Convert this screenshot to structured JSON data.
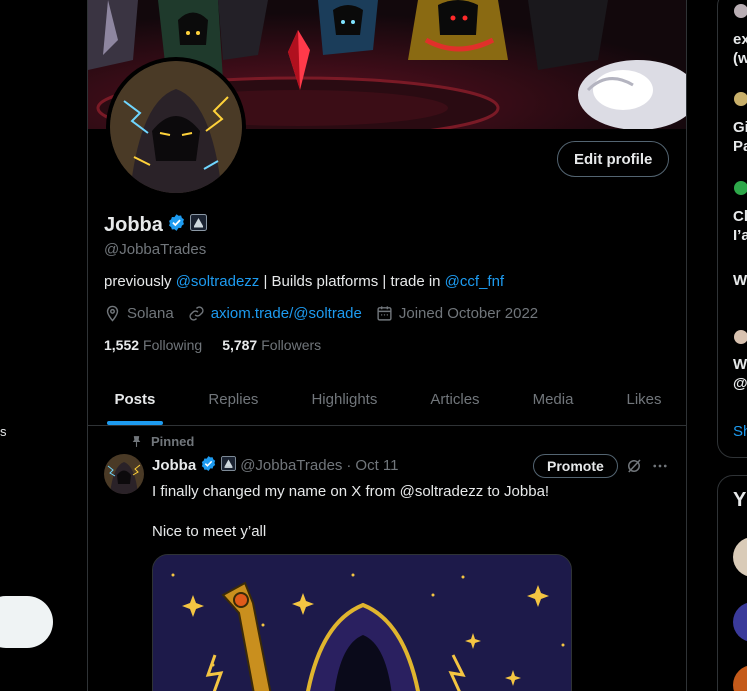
{
  "profile": {
    "display_name": "Jobba",
    "handle": "@JobbaTrades",
    "edit_button": "Edit profile",
    "bio": {
      "prefix": "previously ",
      "mention1": "@soltradezz",
      "middle": " | Builds platforms | trade in ",
      "mention2": "@ccf_fnf"
    },
    "location": "Solana",
    "website": "axiom.trade/@soltrade",
    "joined": "Joined October 2022",
    "following_count": "1,552",
    "following_label": "Following",
    "followers_count": "5,787",
    "followers_label": "Followers"
  },
  "tabs": [
    {
      "label": "Posts",
      "active": true
    },
    {
      "label": "Replies"
    },
    {
      "label": "Highlights"
    },
    {
      "label": "Articles"
    },
    {
      "label": "Media"
    },
    {
      "label": "Likes"
    }
  ],
  "tweet": {
    "pinned_label": "Pinned",
    "name": "Jobba",
    "handle": "@JobbaTrades",
    "separator": "·",
    "date": "Oct 11",
    "promote_label": "Promote",
    "text_line1": "I finally changed my name on X from @soltradezz to Jobba!",
    "text_line2": "Nice to meet y’all"
  },
  "right_sidebar": {
    "items": [
      {
        "line1": "ex",
        "line2": "(w"
      },
      {
        "line1": "Gi",
        "line2": "Pa"
      },
      {
        "line1": "Cl",
        "line2": "I’a"
      },
      {
        "line1": "W",
        "line2": ""
      },
      {
        "line1": "W",
        "line2": "@"
      }
    ],
    "show_more": "Sh",
    "section2_title": "Y"
  },
  "left_nav": {
    "glyph": "s"
  },
  "colors": {
    "accent": "#1d9bf0",
    "text_primary": "#e7e9ea",
    "text_secondary": "#71767b",
    "border": "#2f3336",
    "verified": "#1d9bf0"
  },
  "icons": [
    "verified-badge-icon",
    "affiliate-badge-icon",
    "location-icon",
    "link-icon",
    "calendar-icon",
    "pin-icon",
    "grok-icon",
    "more-icon"
  ]
}
